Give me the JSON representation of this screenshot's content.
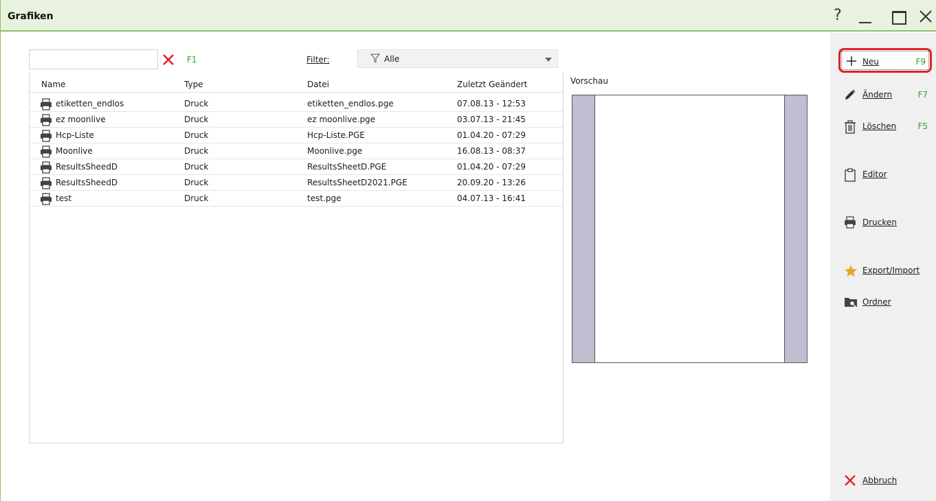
{
  "window": {
    "title": "Grafiken",
    "help": "?"
  },
  "search": {
    "value": "",
    "placeholder": "",
    "shortcut": "F1"
  },
  "filter": {
    "label": "Filter:",
    "selected": "Alle"
  },
  "table": {
    "columns": [
      "Name",
      "Type",
      "Datei",
      "Zuletzt Geändert"
    ],
    "rows": [
      {
        "name": "etiketten_endlos",
        "type": "Druck",
        "file": "etiketten_endlos.pge",
        "modified": "07.08.13 - 12:53"
      },
      {
        "name": "ez moonlive",
        "type": "Druck",
        "file": "ez moonlive.pge",
        "modified": "03.07.13 - 21:45"
      },
      {
        "name": "Hcp-Liste",
        "type": "Druck",
        "file": "Hcp-Liste.PGE",
        "modified": "01.04.20 - 07:29"
      },
      {
        "name": "Moonlive",
        "type": "Druck",
        "file": "Moonlive.pge",
        "modified": "16.08.13 - 08:37"
      },
      {
        "name": "ResultsSheedD",
        "type": "Druck",
        "file": "ResultsSheetD.PGE",
        "modified": "01.04.20 - 07:29"
      },
      {
        "name": "ResultsSheedD",
        "type": "Druck",
        "file": "ResultsSheetD2021.PGE",
        "modified": "20.09.20 - 13:26"
      },
      {
        "name": "test",
        "type": "Druck",
        "file": "test.pge",
        "modified": "04.07.13 - 16:41"
      }
    ]
  },
  "preview": {
    "label": "Vorschau"
  },
  "actions": {
    "new": {
      "label": "Neu",
      "key": "F9"
    },
    "edit": {
      "label": "Ändern",
      "key": "F7"
    },
    "delete": {
      "label": "Löschen",
      "key": "F5"
    },
    "editor": {
      "label": "Editor"
    },
    "print": {
      "label": "Drucken"
    },
    "export": {
      "label": "Export/Import"
    },
    "folder": {
      "label": "Ordner"
    },
    "cancel": {
      "label": "Abbruch"
    }
  },
  "colors": {
    "accent_green": "#2fa12f",
    "titlebar_bg": "#e8f2df",
    "highlight_red": "#e3202a",
    "preview_margin": "#bfbfd1"
  }
}
